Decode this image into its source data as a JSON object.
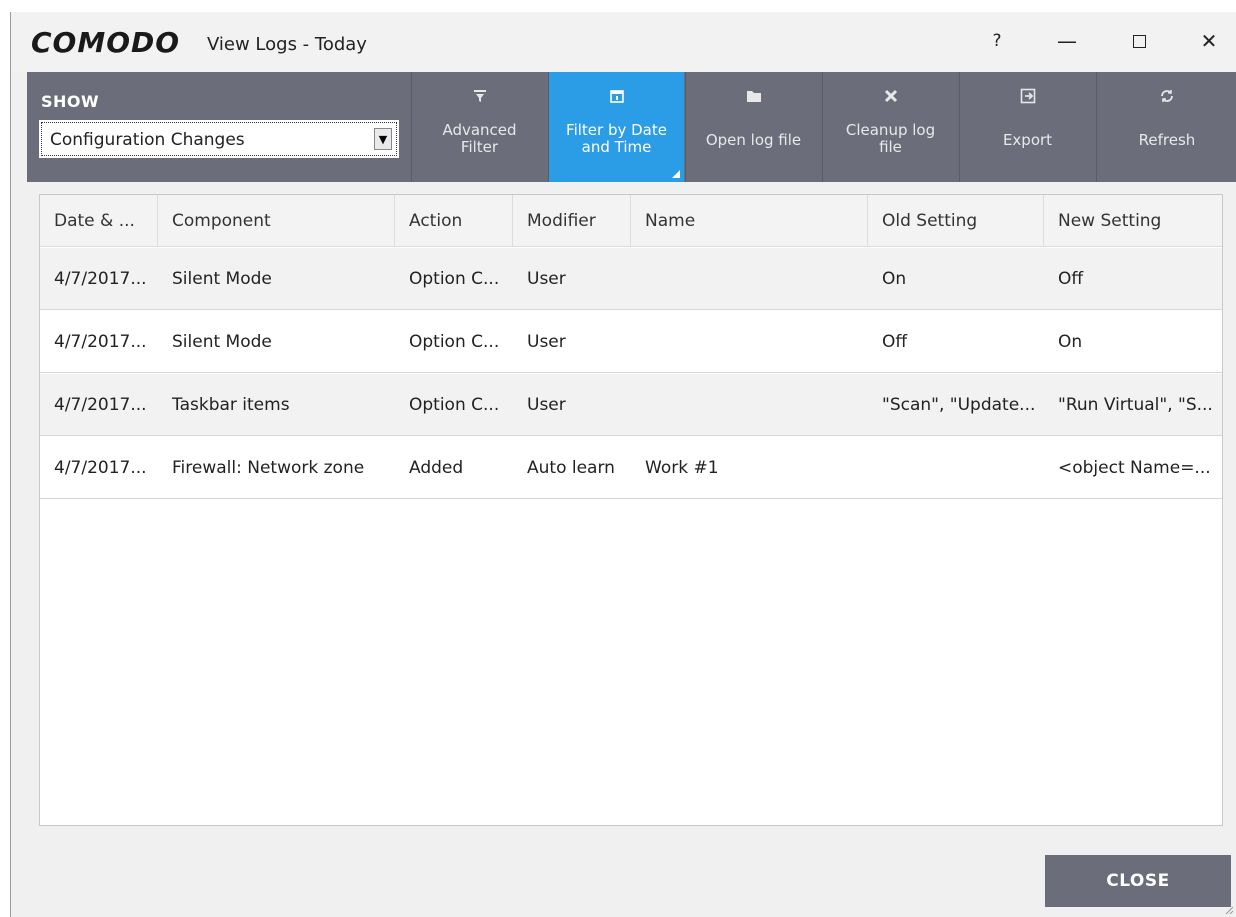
{
  "window": {
    "brand": "COMODO",
    "title": "View Logs - Today",
    "help_label": "?",
    "controls": {
      "minimize": "—",
      "close": "✕"
    }
  },
  "toolbar": {
    "show_label": "SHOW",
    "show_value": "Configuration Changes",
    "buttons": [
      {
        "line1": "Advanced",
        "line2": "Filter",
        "icon": "filter-icon"
      },
      {
        "line1": "Filter by Date",
        "line2": "and Time",
        "icon": "calendar-icon",
        "active": true
      },
      {
        "line1": "Open log file",
        "line2": "",
        "icon": "folder-icon"
      },
      {
        "line1": "Cleanup log",
        "line2": "file",
        "icon": "x-icon"
      },
      {
        "line1": "Export",
        "line2": "",
        "icon": "export-icon"
      },
      {
        "line1": "Refresh",
        "line2": "",
        "icon": "refresh-icon"
      }
    ]
  },
  "table": {
    "columns": [
      "Date & ...",
      "Component",
      "Action",
      "Modifier",
      "Name",
      "Old Setting",
      "New Setting"
    ],
    "rows": [
      [
        "4/7/2017...",
        "Silent Mode",
        "Option C...",
        "User",
        "",
        "On",
        "Off"
      ],
      [
        "4/7/2017...",
        "Silent Mode",
        "Option C...",
        "User",
        "",
        "Off",
        "On"
      ],
      [
        "4/7/2017...",
        "Taskbar items",
        "Option C...",
        "User",
        "",
        "\"Scan\", \"Update...",
        "\"Run Virtual\", \"S..."
      ],
      [
        "4/7/2017...",
        "Firewall: Network zone",
        "Added",
        "Auto learn",
        "Work #1",
        "",
        "<object Name=..."
      ]
    ]
  },
  "footer": {
    "close_label": "CLOSE"
  },
  "colors": {
    "toolbar": "#6b6e7a",
    "accent": "#2a9de6",
    "close_button": "#6b6e7a"
  }
}
